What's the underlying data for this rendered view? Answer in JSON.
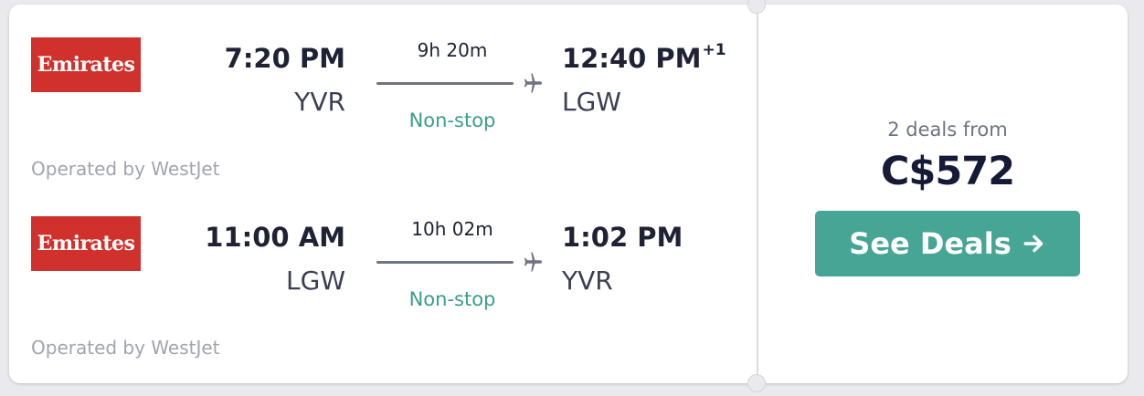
{
  "outbound": {
    "airline": "Emirates",
    "departure_time": "7:20 PM",
    "departure_airport": "YVR",
    "duration": "9h 20m",
    "stops": "Non-stop",
    "arrival_time": "12:40 PM",
    "arrival_day_offset": "+1",
    "arrival_airport": "LGW",
    "operated_by": "Operated by WestJet"
  },
  "return": {
    "airline": "Emirates",
    "departure_time": "11:00 AM",
    "departure_airport": "LGW",
    "duration": "10h 02m",
    "stops": "Non-stop",
    "arrival_time": "1:02 PM",
    "arrival_airport": "YVR",
    "operated_by": "Operated by WestJet"
  },
  "pricing": {
    "deals_label": "2 deals from",
    "price": "C$572",
    "button_label": "See Deals"
  },
  "colors": {
    "airline_logo_bg": "#d0312d",
    "accent_green": "#47a596",
    "nonstop_text": "#3a9e8b",
    "price_text": "#151a36"
  },
  "icons": {
    "plane": "airplane-icon",
    "button_arrow": "arrow-right-icon"
  }
}
